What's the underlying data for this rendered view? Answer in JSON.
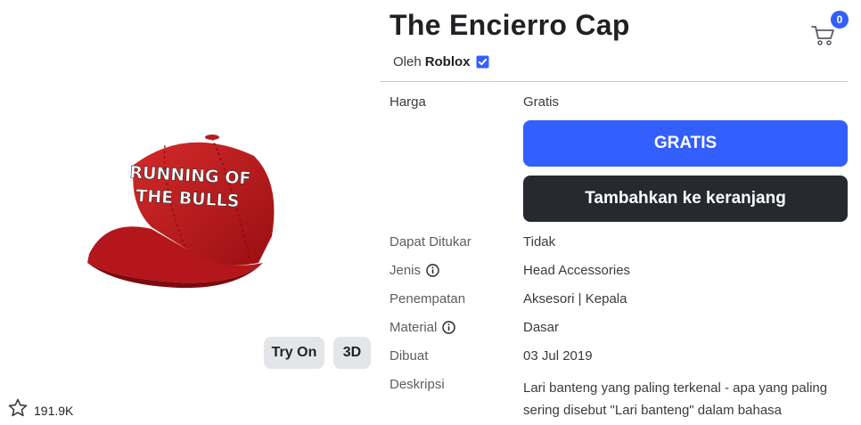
{
  "item": {
    "title": "The Encierro Cap",
    "byline_prefix": "Oleh",
    "creator": "Roblox",
    "image_text": [
      "RUNNING OF",
      "THE BULLS"
    ]
  },
  "media": {
    "try_on_label": "Try On",
    "view_3d_label": "3D",
    "favorite_count": "191.9K"
  },
  "cart": {
    "count": "0"
  },
  "details": {
    "price_label": "Harga",
    "price_value": "Gratis",
    "buy_button": "GRATIS",
    "add_to_cart_button": "Tambahkan ke keranjang",
    "rows": [
      {
        "label": "Dapat Ditukar",
        "value": "Tidak"
      },
      {
        "label": "Jenis",
        "value": "Head Accessories"
      },
      {
        "label": "Penempatan",
        "value": "Aksesori | Kepala"
      },
      {
        "label": "Material",
        "value": "Dasar"
      },
      {
        "label": "Dibuat",
        "value": "03 Jul 2019"
      }
    ],
    "description_label": "Deskripsi",
    "description": "Lari banteng yang paling terkenal - apa yang paling sering disebut \"Lari banteng\" dalam bahasa"
  },
  "colors": {
    "primary": "#335fff",
    "dark_button": "#272930",
    "cap_red": "#c4161c"
  }
}
